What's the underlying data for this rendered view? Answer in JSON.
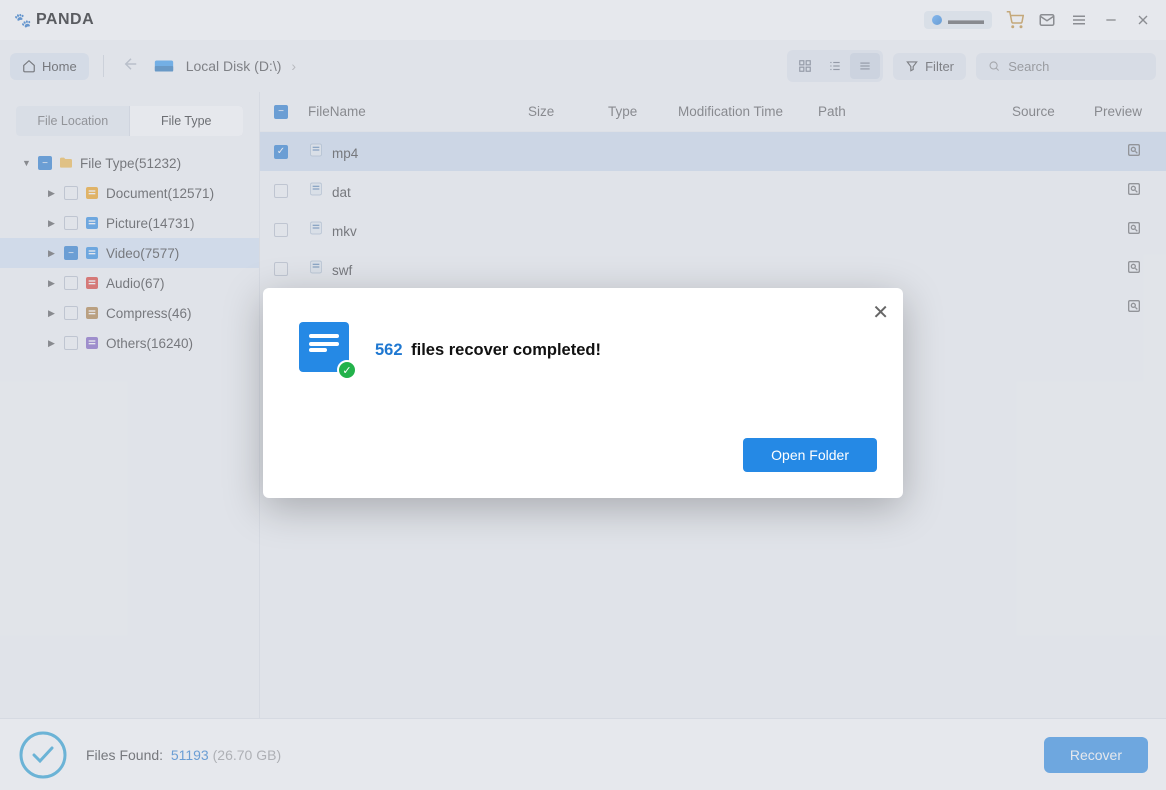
{
  "titlebar": {
    "brand": "PANDA"
  },
  "toolbar": {
    "home": "Home",
    "crumb": "Local Disk (D:\\)",
    "filter": "Filter",
    "search_placeholder": "Search"
  },
  "sidebar": {
    "tabs": {
      "loc": "File Location",
      "type": "File Type"
    },
    "root": "File Type(51232)",
    "items": [
      {
        "label": "Document(12571)",
        "color": "#f59e0b"
      },
      {
        "label": "Picture(14731)",
        "color": "#2589e5"
      },
      {
        "label": "Video(7577)",
        "color": "#2589e5"
      },
      {
        "label": "Audio(67)",
        "color": "#e0362b"
      },
      {
        "label": "Compress(46)",
        "color": "#b07d3b"
      },
      {
        "label": "Others(16240)",
        "color": "#7c5cc4"
      }
    ]
  },
  "columns": {
    "name": "FileName",
    "size": "Size",
    "type": "Type",
    "mod": "Modification Time",
    "path": "Path",
    "source": "Source",
    "preview": "Preview"
  },
  "rows": [
    {
      "name": "mp4",
      "checked": true
    },
    {
      "name": "dat",
      "checked": false
    },
    {
      "name": "mkv",
      "checked": false
    },
    {
      "name": "swf",
      "checked": false
    },
    {
      "name": "",
      "checked": false
    }
  ],
  "footer": {
    "label": "Files Found:",
    "count": "51193",
    "size": "(26.70 GB)",
    "recover": "Recover"
  },
  "modal": {
    "count": "562",
    "message": "files recover completed!",
    "button": "Open Folder"
  }
}
